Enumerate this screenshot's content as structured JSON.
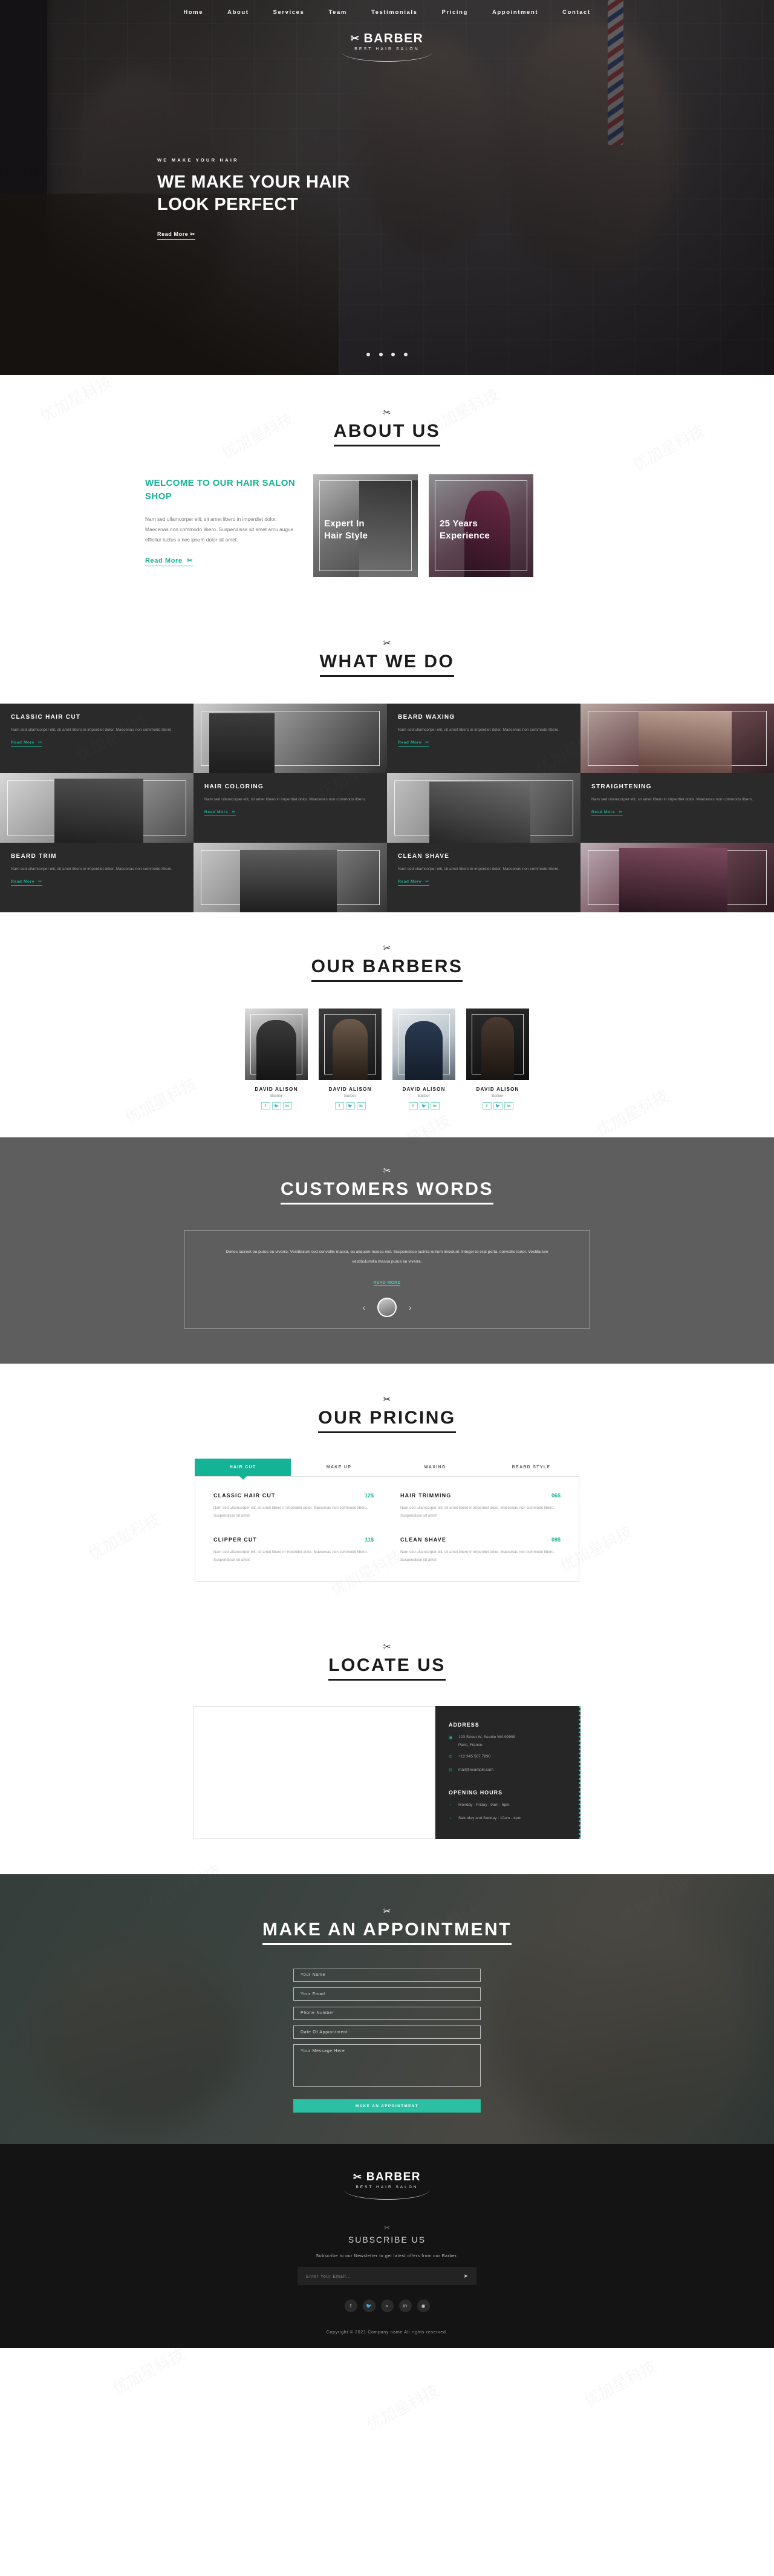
{
  "nav": {
    "items": [
      "Home",
      "About",
      "Services",
      "Team",
      "Testimonials",
      "Pricing",
      "Appointment",
      "Contact"
    ]
  },
  "brand": {
    "scissor_icon": "✂",
    "name": "BARBER",
    "tagline": "BEST HAIR SALON"
  },
  "hero": {
    "kicker": "WE MAKE YOUR HAIR",
    "title_line1": "WE MAKE YOUR HAIR",
    "title_line2": "LOOK PERFECT",
    "button": "Read More",
    "button_icon": "✂",
    "slide_count": 4,
    "active_slide": 1
  },
  "about": {
    "icon": "✂",
    "title": "ABOUT US",
    "heading": "WELCOME TO OUR HAIR SALON SHOP",
    "paragraph": "Nam sed ullamcorper elit, sit amet libero in imperdiet dolor. Maecenas non commodo libero. Suspendisse sit amet arcu augue efficitur luctus a nec ipsum dolor sit amet.",
    "read_more": "Read More",
    "read_more_icon": "✂",
    "cards": [
      {
        "line1": "Expert In",
        "line2": "Hair Style"
      },
      {
        "line1": "25 Years",
        "line2": "Experience"
      }
    ]
  },
  "services": {
    "icon": "✂",
    "title": "WHAT WE DO",
    "read_more": "Read More",
    "read_more_icon": "✂",
    "body": "Nam sed ullamcorper elit, sit amet libero in imperdiet dolor. Maecenas non commodo libero.",
    "items": [
      {
        "title": "CLASSIC HAIR CUT"
      },
      {
        "title": "BEARD WAXING"
      },
      {
        "title": "HAIR COLORING"
      },
      {
        "title": "STRAIGHTENING"
      },
      {
        "title": "BEARD TRIM"
      },
      {
        "title": "CLEAN SHAVE"
      }
    ]
  },
  "barbers": {
    "icon": "✂",
    "title": "OUR BARBERS",
    "members": [
      {
        "name": "DAVID ALISON",
        "role": "Barber"
      },
      {
        "name": "DAVID ALISON",
        "role": "Barber"
      },
      {
        "name": "DAVID ALISON",
        "role": "Barber"
      },
      {
        "name": "DAVID ALISON",
        "role": "Barber"
      }
    ],
    "social": [
      "f",
      "t",
      "in"
    ]
  },
  "testimonials": {
    "icon": "✂",
    "title": "CUSTOMERS WORDS",
    "quote": "Donec laoreet eu purus eu viverra. Vestibulum sed convallis massa, eu aliquam massa nisl. Suspendisse lacinia rutrum tincidunt. Integer id erat porta, convallis tortor. Vestibulum vestibulumilla massa purus eu viverra.",
    "read_more": "READ MORE",
    "prev": "‹",
    "next": "›"
  },
  "pricing": {
    "icon": "✂",
    "title": "OUR PRICING",
    "tabs": [
      "HAIR CUT",
      "MAKE UP",
      "WAXING",
      "BEARD STYLE"
    ],
    "active_tab": "HAIR CUT",
    "items": [
      {
        "name": "CLASSIC HAIR CUT",
        "price": "12$",
        "desc": "Nam sed ullamcorper elit, sit amet libero in imperdiet dolor. Maecenas non commodo libero. Suspendisse sit amet"
      },
      {
        "name": "HAIR TRIMMING",
        "price": "06$",
        "desc": "Nam sed ullamcorper elit, sit amet libero in imperdiet dolor. Maecenas non commodo libero. Suspendisse sit amet"
      },
      {
        "name": "CLIPPER CUT",
        "price": "11$",
        "desc": "Nam sed ullamcorper elit, sit amet libero in imperdiet dolor. Maecenas non commodo libero. Suspendisse sit amet"
      },
      {
        "name": "CLEAN SHAVE",
        "price": "09$",
        "desc": "Nam sed ullamcorper elit, sit amet libero in imperdiet dolor. Maecenas non commodo libero. Suspendisse sit amet"
      }
    ]
  },
  "locate": {
    "icon": "✂",
    "title": "LOCATE US",
    "address_heading": "ADDRESS",
    "address_line1": "123 Street W, Seattle WA 99999",
    "address_line2": "Paris, France.",
    "phone": "+12 345 567 7890",
    "email": "mail@example.com",
    "hours_heading": "OPENING HOURS",
    "hours": [
      "Monday - Friday : 9am - 6pm",
      "Saturday and Sunday : 10am - 4pm"
    ],
    "map_icon": "▣",
    "phone_icon": "✆",
    "mail_icon": "✉",
    "clock_icon": "◔"
  },
  "appointment": {
    "icon": "✂",
    "title": "MAKE AN APPOINTMENT",
    "fields": [
      {
        "placeholder": "Your Name",
        "value": ""
      },
      {
        "placeholder": "Your Email",
        "value": ""
      },
      {
        "placeholder": "Phone Number",
        "value": ""
      },
      {
        "placeholder": "Date Of Appiontment",
        "value": ""
      }
    ],
    "message_placeholder": "Your Message Here",
    "submit": "MAKE AN APPOINTMENT"
  },
  "footer": {
    "subscribe_icon": "✂",
    "subscribe_title": "SUBSCRIBE US",
    "subscribe_note": "Subscribe to our Newsletter to get latest offers from our Barber.",
    "email_placeholder": "Enter Your Email...",
    "send_icon": "➤",
    "social": [
      "f",
      "t",
      "≈",
      "in",
      "◉"
    ],
    "copyright": "Copyright © 2021.Company name All rights reserved."
  },
  "colors": {
    "accent": "#14b396",
    "dark": "#141414",
    "gray": "#5e5e5e"
  }
}
